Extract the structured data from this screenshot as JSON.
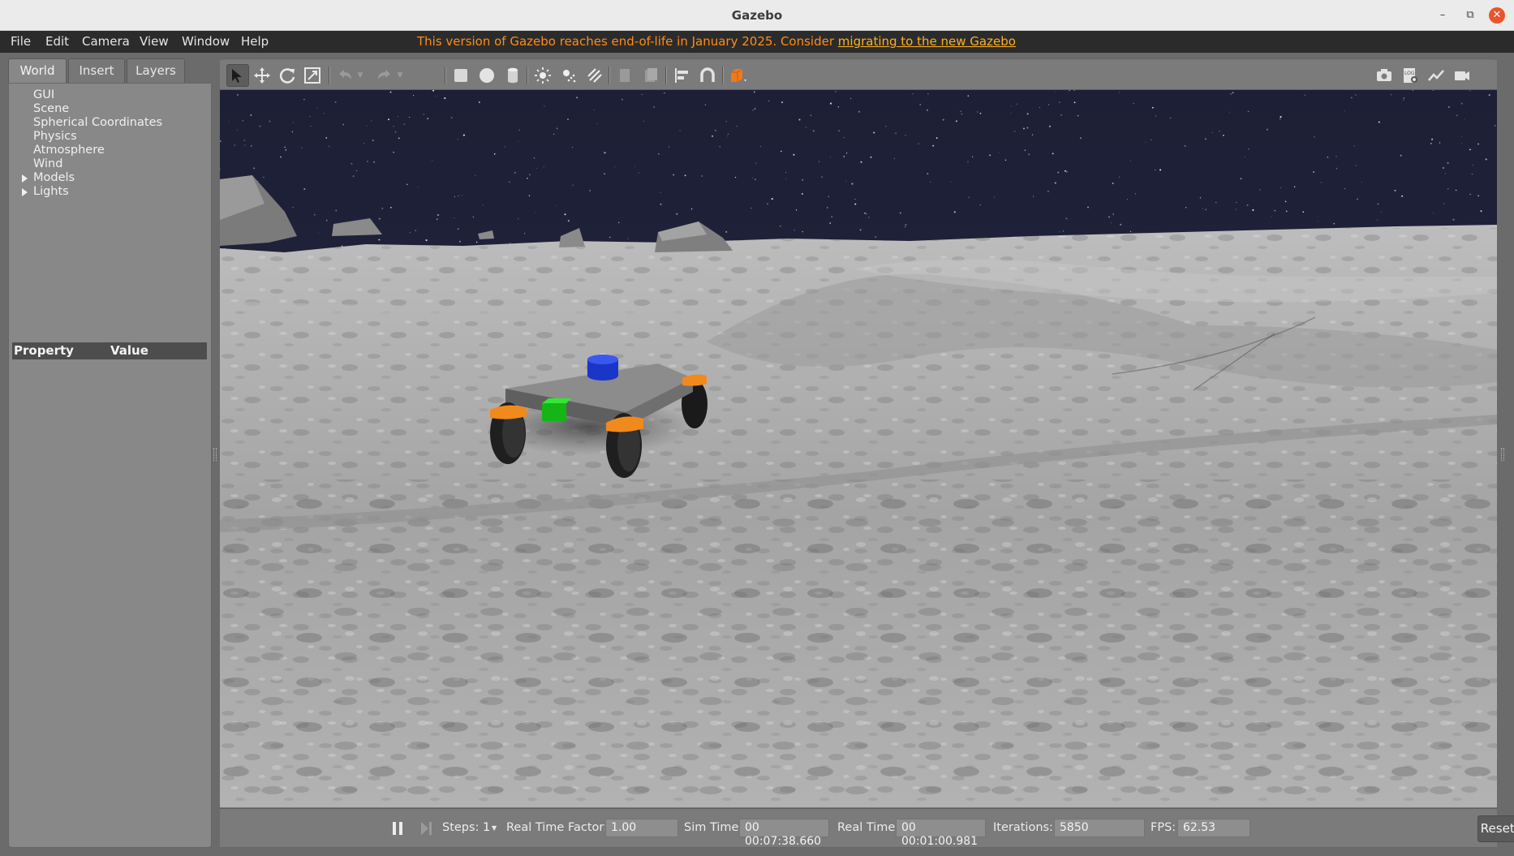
{
  "window": {
    "title": "Gazebo"
  },
  "menu": {
    "items": [
      "File",
      "Edit",
      "Camera",
      "View",
      "Window",
      "Help"
    ],
    "eol_notice": "This version of Gazebo reaches end-of-life in January 2025. Consider ",
    "eol_link": "migrating to the new Gazebo"
  },
  "left_panel": {
    "tabs": [
      "World",
      "Insert",
      "Layers"
    ],
    "active_tab": "World",
    "tree": [
      "GUI",
      "Scene",
      "Spherical Coordinates",
      "Physics",
      "Atmosphere",
      "Wind",
      "Models",
      "Lights"
    ],
    "expandable": [
      "Models",
      "Lights"
    ],
    "property_header": {
      "property": "Property",
      "value": "Value"
    }
  },
  "toolbar": {
    "icons": [
      "select-icon",
      "translate-icon",
      "rotate-icon",
      "scale-icon",
      "undo-icon",
      "undo-dropdown-icon",
      "redo-icon",
      "redo-dropdown-icon",
      "box-icon",
      "sphere-icon",
      "cylinder-icon",
      "point-light-icon",
      "spot-light-icon",
      "directional-light-icon",
      "copy-icon",
      "paste-icon",
      "align-icon",
      "snap-icon",
      "view-angle-icon",
      "screenshot-icon",
      "log-icon",
      "plot-icon",
      "record-video-icon"
    ],
    "active": "select-icon"
  },
  "status": {
    "steps_label": "Steps:",
    "steps_value": "1",
    "rtf_label": "Real Time Factor:",
    "rtf_value": "1.00",
    "sim_time_label": "Sim Time:",
    "sim_time_value": "00 00:07:38.660",
    "real_time_label": "Real Time:",
    "real_time_value": "00 00:01:00.981",
    "iterations_label": "Iterations:",
    "iterations_value": "5850",
    "fps_label": "FPS:",
    "fps_value": "62.53",
    "reset_label": "Reset Time"
  },
  "colors": {
    "menubar": "#2b2b2b",
    "eol_text": "#ff8c1a",
    "panel": "#888888",
    "sky": "#1d1f36",
    "terrain": "#a8a8a8",
    "wheel_cap": "#f08a1c",
    "sensor_blue": "#1f3fd0",
    "sensor_green": "#1fd01f",
    "close_button": "#e9542a"
  }
}
